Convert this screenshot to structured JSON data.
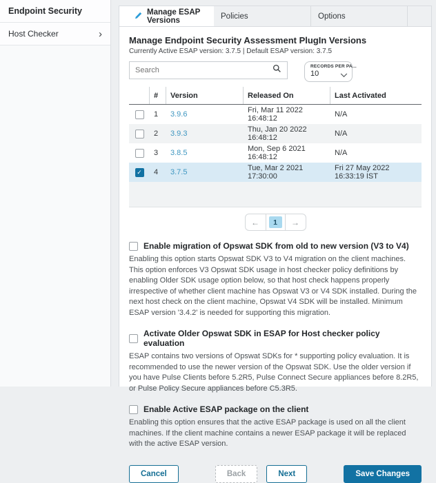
{
  "sidebar": {
    "header": "Endpoint Security",
    "items": [
      {
        "label": "Host Checker",
        "chevron": "›"
      }
    ]
  },
  "tabs": [
    {
      "label": "Manage ESAP Versions",
      "active": true
    },
    {
      "label": "Policies",
      "active": false
    },
    {
      "label": "Options",
      "active": false
    }
  ],
  "main": {
    "title": "Manage Endpoint Security Assessment PlugIn Versions",
    "subtitle": "Currently Active ESAP version: 3.7.5 | Default ESAP version: 3.7.5",
    "search": {
      "placeholder": "Search"
    },
    "records_per_page": {
      "label": "RECORDS PER PA...",
      "value": "10"
    }
  },
  "table": {
    "headers": [
      "#",
      "Version",
      "Released On",
      "Last Activated"
    ],
    "rows": [
      {
        "num": "1",
        "version": "3.9.6",
        "released": "Fri, Mar 11 2022 16:48:12",
        "last_activated": "N/A",
        "checked": false
      },
      {
        "num": "2",
        "version": "3.9.3",
        "released": "Thu, Jan 20 2022 16:48:12",
        "last_activated": "N/A",
        "checked": false
      },
      {
        "num": "3",
        "version": "3.8.5",
        "released": "Mon, Sep 6 2021 16:48:12",
        "last_activated": "N/A",
        "checked": false
      },
      {
        "num": "4",
        "version": "3.7.5",
        "released": "Tue, Mar 2 2021 17:30:00",
        "last_activated": "Fri 27 May 2022 16:33:19 IST",
        "checked": true
      }
    ]
  },
  "pagination": {
    "prev": "←",
    "page": "1",
    "next": "→"
  },
  "options": [
    {
      "title": "Enable migration of Opswat SDK from old to new version (V3 to V4)",
      "checked": false,
      "description": "Enabling this option starts Opswat SDK V3 to V4 migration on the client machines. This option enforces V3 Opswat SDK usage in host checker policy definitions by enabling Older SDK usage option below, so that host check happens properly irrespective of whether client machine has Opswat V3 or V4 SDK installed. During the next host check on the client machine, Opswat V4 SDK will be installed. Minimum ESAP version '3.4.2' is needed for supporting this migration."
    },
    {
      "title": "Activate Older Opswat SDK in ESAP for Host checker policy evaluation",
      "checked": false,
      "description": "ESAP contains two versions of Opswat SDKs for * supporting policy evaluation. It is recommended to use the newer version of the Opswat SDK. Use the older version if you have Pulse Clients before 5.2R5, Pulse Connect Secure appliances before 8.2R5, or Pulse Policy Secure appliances before C5.3R5."
    },
    {
      "title": "Enable Active ESAP package on the client",
      "checked": false,
      "description": "Enabling this option ensures that the active ESAP package is used on all the client machines. If the client machine contains a newer ESAP package it will be replaced with the active ESAP version."
    }
  ],
  "buttons": {
    "cancel": "Cancel",
    "back": "Back",
    "next": "Next",
    "save": "Save Changes"
  },
  "colors": {
    "accent": "#1272a3",
    "link": "#3e96c0",
    "selected_row": "#d8eaf5",
    "page_background": "#edeff1",
    "tabstrip_background": "#eef0f2"
  }
}
